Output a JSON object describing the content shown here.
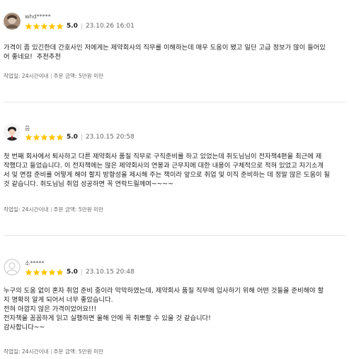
{
  "reviews": [
    {
      "username": "whd*****",
      "score": "5.0",
      "date": "23.10.26 16:01",
      "text": "가격이 좀 있긴한데 간호사인 저에게는 제약회사의 직무를 이해하는데 매우 도움이 됐고 일단 고급 정보가 많이 들어있\n어 좋네요!  추천추천",
      "delivery": "작업일: 24시간이내",
      "order": "주문 금액: 5만원 미만"
    },
    {
      "username": "음",
      "score": "5.0",
      "date": "23.10.15 20:58",
      "text": "첫 번째 회사에서 퇴사하고 다른 제약회사 품질 직무로 구직준비를 하고 있었는데 취도님님이 전자책4편을 최근에 제\n작했다고 들었습니다. 이 전자책에는 많은 제약회사의 연봉과 근무지에 대한 내용이 구체적으로 적혀 있었고 자기소개\n서 및 면접 준비를 어떻게 해야 할지 방향성을 제시해 주는 책이라 앞으로 취업 및 이직 준비하는 데 정말 많은 도움이 될\n것 같습니다. 취도님님 취업 성공하면 꼭 연락드릴께여~~~~",
      "delivery": "작업일: 24시간이내",
      "order": "주문 금액: 5만원 미만"
    },
    {
      "username": "소*****",
      "score": "5.0",
      "date": "23.10.15 20:48",
      "text": "누구의 도움 없이 혼자 취업 준비 중이라 막막하였는데, 제약회사 품질 직무에 입사하기 위해 어떤 것들을 준비해야 할\n지 명확히 알게 되어서 너무 좋았습니다.\n전혀 아깝지 않은 가격이었어요!!!\n전자책을 꼼꼼하게 읽고 실행하면 올해 안에 꼭 취뽀할 수 있을 것 같습니다!\n감사합니다~~",
      "delivery": "작업일: 24시간이내",
      "order": "주문 금액: 5만원 미만"
    }
  ],
  "colors": {
    "star": "#ffc400",
    "divider": "#e6e6e6",
    "meta": "#666666"
  },
  "icons": {
    "star": "star-icon",
    "avatar_default": "person-outline-icon"
  }
}
